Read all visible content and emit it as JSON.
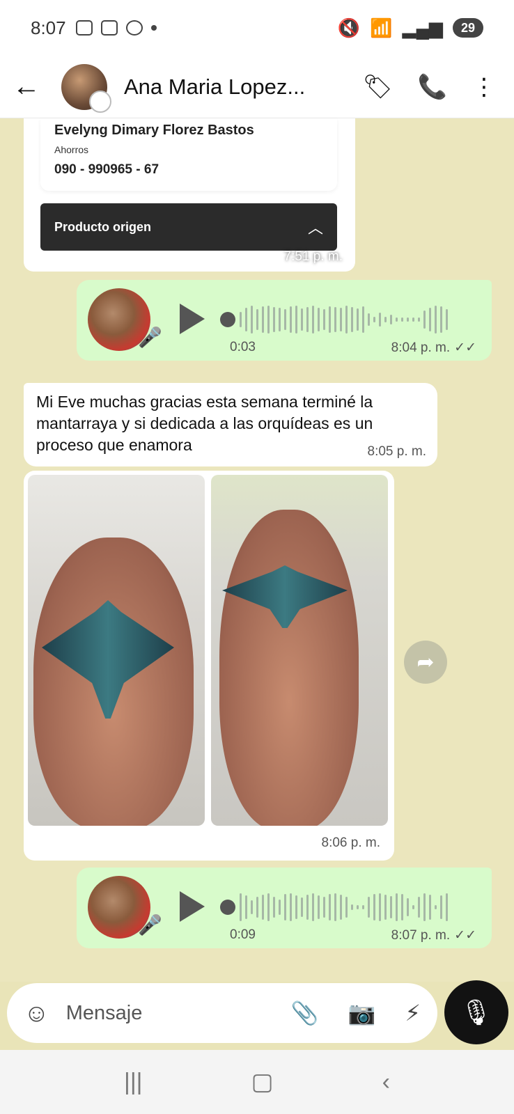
{
  "status_bar": {
    "time": "8:07",
    "battery": "29"
  },
  "header": {
    "contact_name": "Ana Maria Lopez..."
  },
  "receipt": {
    "name": "Evelyng Dimary Florez Bastos",
    "account_type": "Ahorros",
    "account_number": "090 - 990965 - 67",
    "product_label": "Producto origen",
    "time": "7:51 p. m."
  },
  "voice_messages": [
    {
      "duration": "0:03",
      "time": "8:04 p. m.",
      "status_icon": "double-check-icon"
    },
    {
      "duration": "0:09",
      "time": "8:07 p. m.",
      "status_icon": "double-check-icon"
    }
  ],
  "text_message": {
    "text": "Mi Eve muchas gracias esta semana terminé la mantarraya y si dedicada a las orquídeas es un proceso que enamora",
    "time": "8:05 p. m."
  },
  "photo_message": {
    "time": "8:06 p. m."
  },
  "input": {
    "placeholder": "Mensaje"
  },
  "colors": {
    "chat_background": "#ebe6bd",
    "outgoing_bubble": "#d8fbcb",
    "incoming_bubble": "#ffffff",
    "mic_button": "#121212"
  }
}
